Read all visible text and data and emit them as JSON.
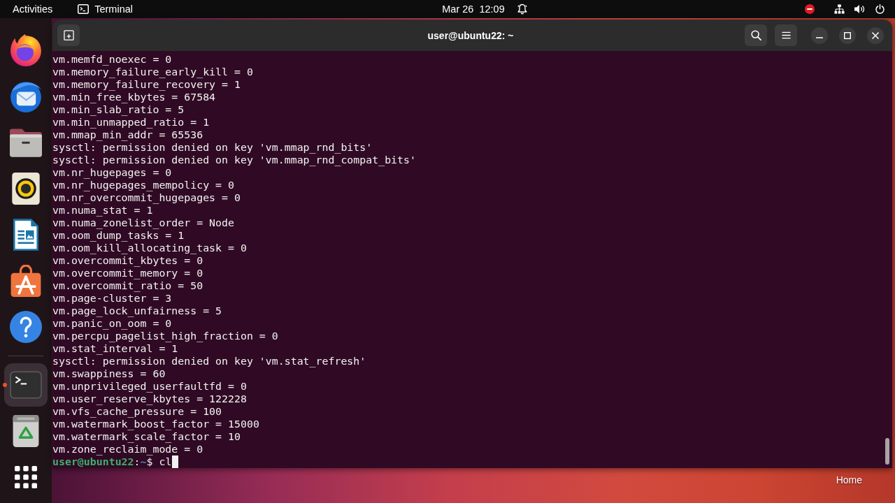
{
  "top_bar": {
    "activities": "Activities",
    "app_menu": {
      "label": "Terminal"
    },
    "clock": "Mar 26  12:09"
  },
  "dock": {
    "favorites": [
      {
        "kind": "browser",
        "running": false,
        "selected": false
      },
      {
        "kind": "mail",
        "running": false,
        "selected": false
      },
      {
        "kind": "files",
        "running": false,
        "selected": false
      },
      {
        "kind": "music",
        "running": false,
        "selected": false
      },
      {
        "kind": "writer",
        "running": false,
        "selected": false
      },
      {
        "kind": "store",
        "running": false,
        "selected": false
      },
      {
        "kind": "help",
        "running": false,
        "selected": false
      }
    ],
    "others": [
      {
        "kind": "terminal",
        "running": true,
        "selected": true
      },
      {
        "kind": "trash",
        "running": false,
        "selected": false
      }
    ]
  },
  "terminal": {
    "title": "user@ubuntu22: ~",
    "lines": [
      "vm.memfd_noexec = 0",
      "vm.memory_failure_early_kill = 0",
      "vm.memory_failure_recovery = 1",
      "vm.min_free_kbytes = 67584",
      "vm.min_slab_ratio = 5",
      "vm.min_unmapped_ratio = 1",
      "vm.mmap_min_addr = 65536",
      "sysctl: permission denied on key 'vm.mmap_rnd_bits'",
      "sysctl: permission denied on key 'vm.mmap_rnd_compat_bits'",
      "vm.nr_hugepages = 0",
      "vm.nr_hugepages_mempolicy = 0",
      "vm.nr_overcommit_hugepages = 0",
      "vm.numa_stat = 1",
      "vm.numa_zonelist_order = Node",
      "vm.oom_dump_tasks = 1",
      "vm.oom_kill_allocating_task = 0",
      "vm.overcommit_kbytes = 0",
      "vm.overcommit_memory = 0",
      "vm.overcommit_ratio = 50",
      "vm.page-cluster = 3",
      "vm.page_lock_unfairness = 5",
      "vm.panic_on_oom = 0",
      "vm.percpu_pagelist_high_fraction = 0",
      "vm.stat_interval = 1",
      "sysctl: permission denied on key 'vm.stat_refresh'",
      "vm.swappiness = 60",
      "vm.unprivileged_userfaultfd = 0",
      "vm.user_reserve_kbytes = 122228",
      "vm.vfs_cache_pressure = 100",
      "vm.watermark_boost_factor = 15000",
      "vm.watermark_scale_factor = 10",
      "vm.zone_reclaim_mode = 0"
    ],
    "prompt": {
      "user_host": "user@ubuntu22",
      "separator": ":",
      "path": "~",
      "symbol": "$",
      "input": "cl"
    }
  },
  "desktop": {
    "icons": [
      {
        "label": "Home"
      }
    ]
  }
}
